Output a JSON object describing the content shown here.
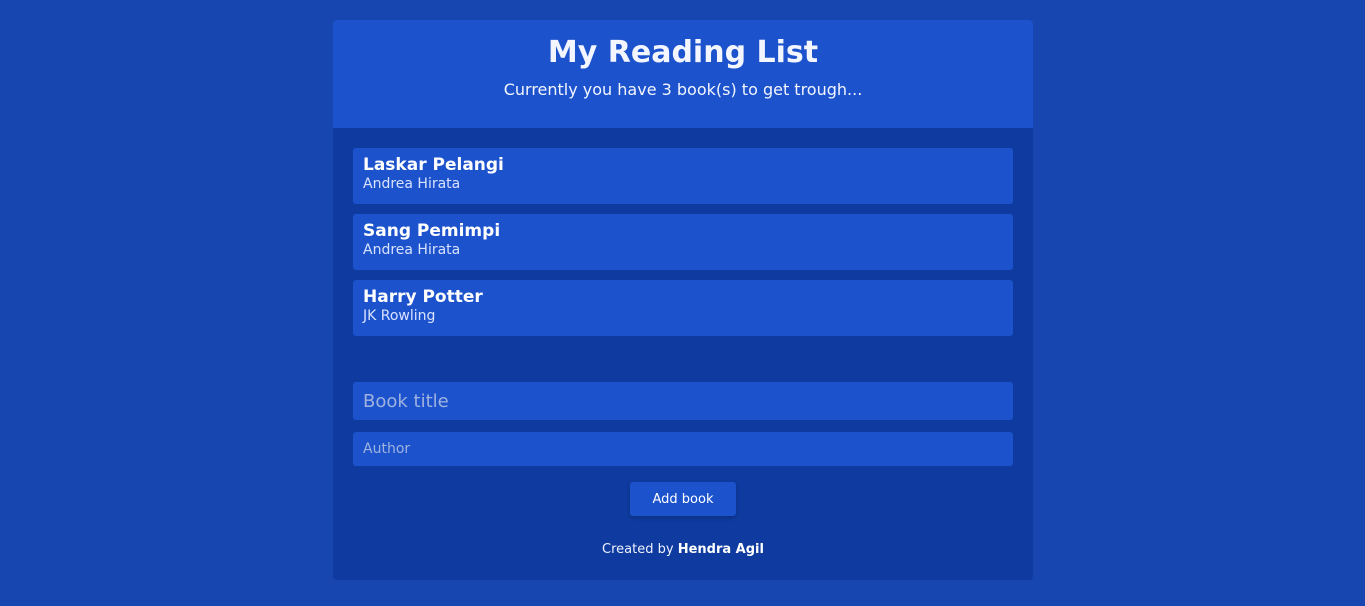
{
  "header": {
    "title": "My Reading List",
    "subtitle": "Currently you have 3 book(s) to get trough..."
  },
  "books": [
    {
      "title": "Laskar Pelangi",
      "author": "Andrea Hirata"
    },
    {
      "title": "Sang Pemimpi",
      "author": "Andrea Hirata"
    },
    {
      "title": "Harry Potter",
      "author": "JK Rowling"
    }
  ],
  "form": {
    "title_placeholder": "Book title",
    "title_value": "",
    "author_placeholder": "Author",
    "author_value": "",
    "submit_label": "Add book"
  },
  "footer": {
    "prefix": "Created by",
    "author_name": "Hendra Agil"
  },
  "colors": {
    "page_background": "#1746b0",
    "panel_background": "#0f3ba0",
    "card_background": "#1c53cc"
  }
}
